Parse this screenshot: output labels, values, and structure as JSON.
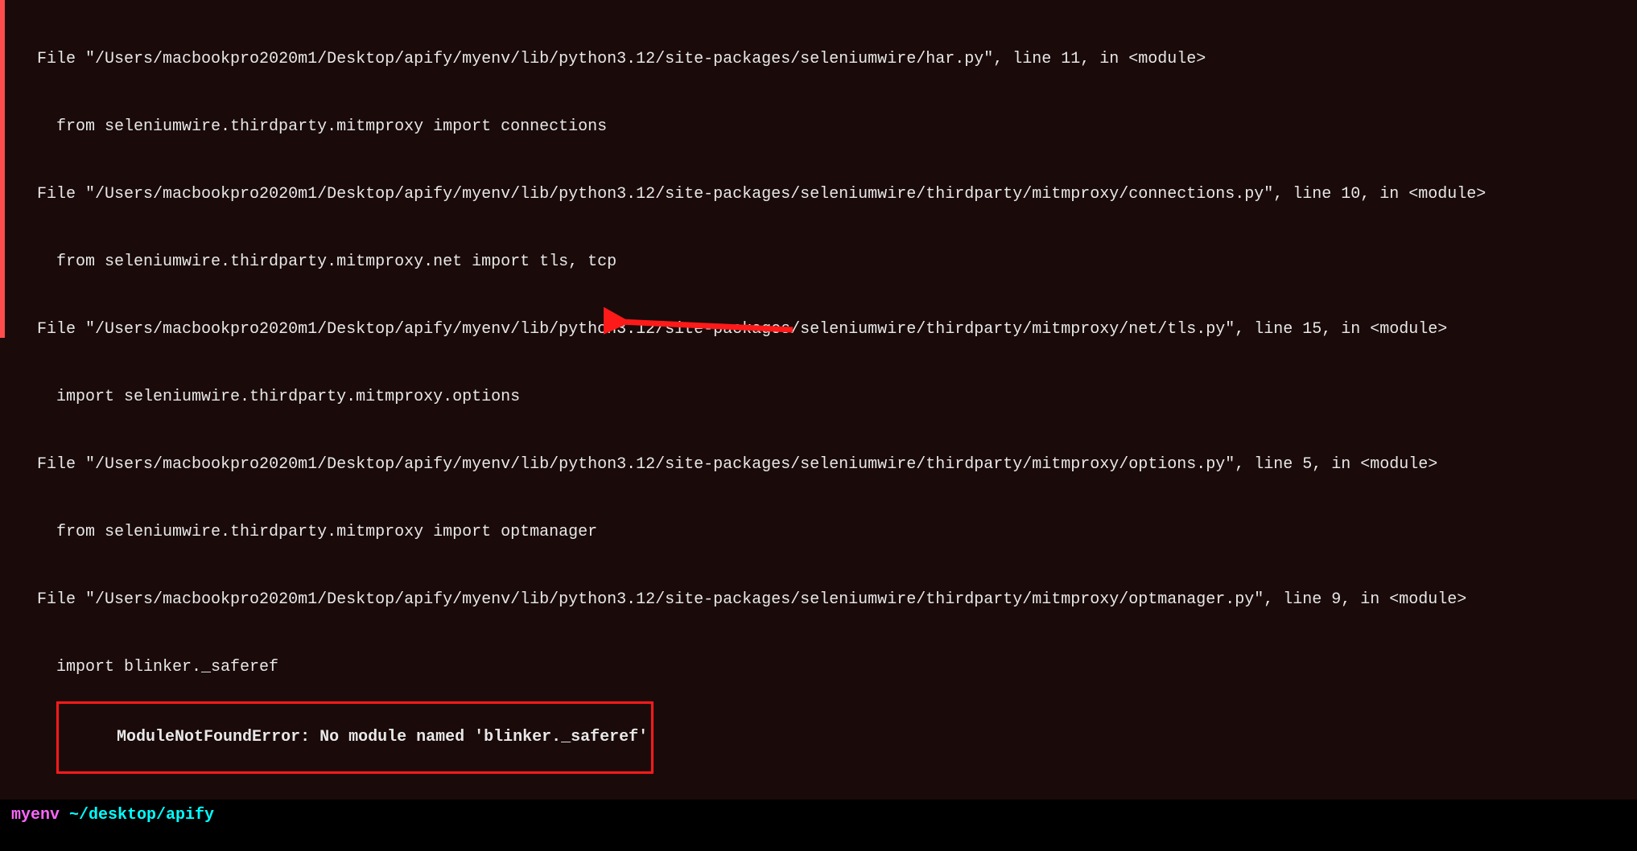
{
  "traceback": {
    "lines": [
      "  File \"/Users/macbookpro2020m1/Desktop/apify/myenv/lib/python3.12/site-packages/seleniumwire/har.py\", line 11, in <module>",
      "    from seleniumwire.thirdparty.mitmproxy import connections",
      "  File \"/Users/macbookpro2020m1/Desktop/apify/myenv/lib/python3.12/site-packages/seleniumwire/thirdparty/mitmproxy/connections.py\", line 10, in <module>",
      "    from seleniumwire.thirdparty.mitmproxy.net import tls, tcp",
      "  File \"/Users/macbookpro2020m1/Desktop/apify/myenv/lib/python3.12/site-packages/seleniumwire/thirdparty/mitmproxy/net/tls.py\", line 15, in <module>",
      "    import seleniumwire.thirdparty.mitmproxy.options",
      "  File \"/Users/macbookpro2020m1/Desktop/apify/myenv/lib/python3.12/site-packages/seleniumwire/thirdparty/mitmproxy/options.py\", line 5, in <module>",
      "    from seleniumwire.thirdparty.mitmproxy import optmanager",
      "  File \"/Users/macbookpro2020m1/Desktop/apify/myenv/lib/python3.12/site-packages/seleniumwire/thirdparty/mitmproxy/optmanager.py\", line 9, in <module>",
      "    import blinker._saferef"
    ],
    "error": "ModuleNotFoundError: No module named 'blinker._saferef'"
  },
  "prompt": {
    "env": "myenv",
    "path": "~/desktop/apify"
  },
  "colors": {
    "highlight_border": "#ff1a1a",
    "arrow": "#ff1a1a",
    "env": "#ff66ff",
    "path": "#00ffff"
  }
}
